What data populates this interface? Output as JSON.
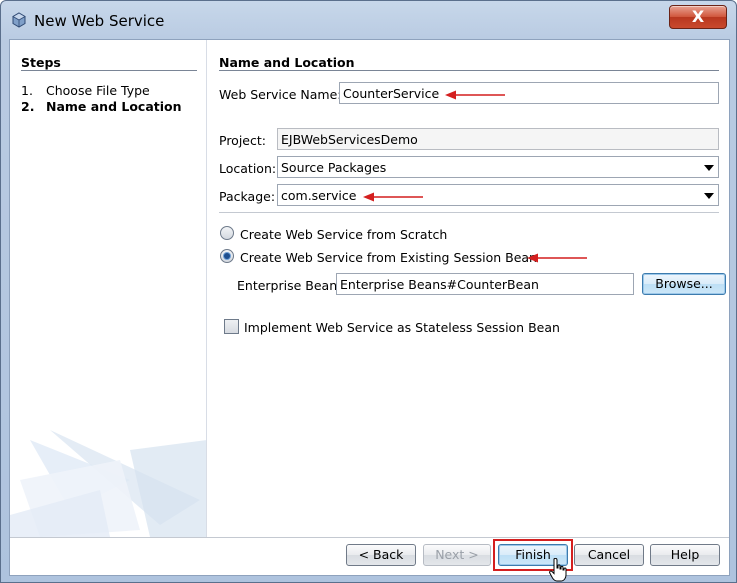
{
  "window": {
    "title": "New Web Service",
    "close_label": "X"
  },
  "steps": {
    "title": "Steps",
    "items": [
      {
        "num": "1.",
        "label": "Choose File Type"
      },
      {
        "num": "2.",
        "label": "Name and Location"
      }
    ]
  },
  "main": {
    "section_title": "Name and Location",
    "web_service_name": {
      "label": "Web Service Name:",
      "value": "CounterService"
    },
    "project": {
      "label": "Project:",
      "value": "EJBWebServicesDemo"
    },
    "location": {
      "label": "Location:",
      "value": "Source Packages"
    },
    "package": {
      "label": "Package:",
      "value": "com.service"
    },
    "radio_scratch": {
      "label": "Create Web Service from Scratch",
      "checked": false
    },
    "radio_session_bean": {
      "label": "Create Web Service from Existing Session Bean",
      "checked": true
    },
    "enterprise_bean": {
      "label": "Enterprise Bean:",
      "value": "Enterprise Beans#CounterBean"
    },
    "browse_label": "Browse...",
    "stateless_checkbox": {
      "label": "Implement Web Service as Stateless Session Bean",
      "checked": false
    }
  },
  "buttons": {
    "back": "< Back",
    "next": "Next >",
    "finish": "Finish",
    "cancel": "Cancel",
    "help": "Help"
  },
  "colors": {
    "annotation_red": "#d41f1f",
    "title_bar": "#b9cbe2",
    "close_button": "#c9492d"
  }
}
